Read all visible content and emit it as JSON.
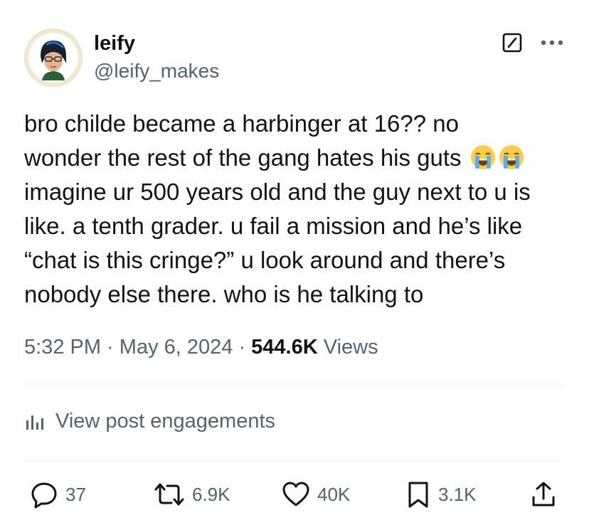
{
  "author": {
    "display_name": "leify",
    "handle": "@leify_makes"
  },
  "tweet": {
    "lines": [
      "bro childe became a harbinger at 16?? no",
      "wonder the rest of the gang hates his guts",
      "imagine ur 500 years old and the guy next to u is",
      "like. a tenth grader. u fail a mission and he’s like",
      "“chat is this cringe?” u look around and there’s",
      "nobody else there. who is he talking to"
    ],
    "emoji": [
      "loudly-crying-face",
      "loudly-crying-face"
    ]
  },
  "meta": {
    "time": "5:32 PM",
    "separator": " · ",
    "date": "May 6, 2024",
    "views_count": "544.6K",
    "views_label": " Views"
  },
  "engagements": {
    "label": "View post engagements"
  },
  "actions": {
    "replies": "37",
    "reposts": "6.9K",
    "likes": "40K",
    "bookmarks": "3.1K"
  },
  "colors": {
    "text": "#0f1419",
    "secondary": "#536471",
    "divider": "#eff3f4"
  },
  "icons": [
    "grok-icon",
    "more-icon",
    "analytics-icon",
    "reply-icon",
    "repost-icon",
    "like-icon",
    "bookmark-icon",
    "share-icon"
  ]
}
